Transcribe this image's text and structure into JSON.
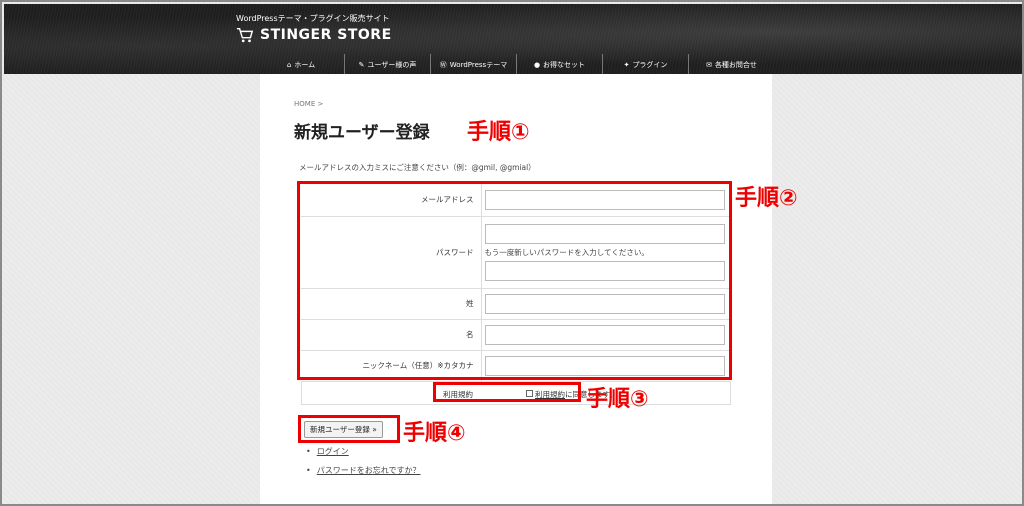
{
  "header": {
    "tagline": "WordPressテーマ・プラグイン販売サイト",
    "logo_text": "STINGER STORE",
    "nav": [
      {
        "glyph": "⌂",
        "label": "ホーム",
        "icon": "home-icon"
      },
      {
        "glyph": "✎",
        "label": "ユーザー様の声",
        "icon": "comment-icon"
      },
      {
        "glyph": "Ⓦ",
        "label": "WordPressテーマ",
        "icon": "wordpress-icon"
      },
      {
        "glyph": "●",
        "label": "お得なセット",
        "icon": "gift-icon"
      },
      {
        "glyph": "✦",
        "label": "プラグイン",
        "icon": "plug-icon"
      },
      {
        "glyph": "✉",
        "label": "各種お問合せ",
        "icon": "mail-icon"
      }
    ]
  },
  "breadcrumb": "HOME >",
  "page_title": "新規ユーザー登録",
  "notice": "メールアドレスの入力ミスにご注意ください（例：@gmil, @gmial）",
  "form": {
    "email_label": "メールアドレス",
    "email_value": "",
    "password_label": "パスワード",
    "password_value": "",
    "password_hint": "もう一度新しいパスワードを入力してください。",
    "password_confirm_value": "",
    "last_name_label": "姓",
    "last_name_value": "",
    "first_name_label": "名",
    "first_name_value": "",
    "nickname_label": "ニックネーム（任意）※カタカナ",
    "nickname_value": "",
    "terms_label": "利用規約",
    "terms_link": "利用規約",
    "terms_suffix": "に同意します。",
    "submit_label": "新規ユーザー登録 »"
  },
  "links": {
    "login": "ログイン",
    "forgot_password": "パスワードをお忘れですか？"
  },
  "annotations": {
    "step1": "手順①",
    "step2": "手順②",
    "step3": "手順③",
    "step4": "手順④"
  },
  "colors": {
    "annotation_red": "#e00000",
    "header_bg": "#1e1e1e"
  }
}
